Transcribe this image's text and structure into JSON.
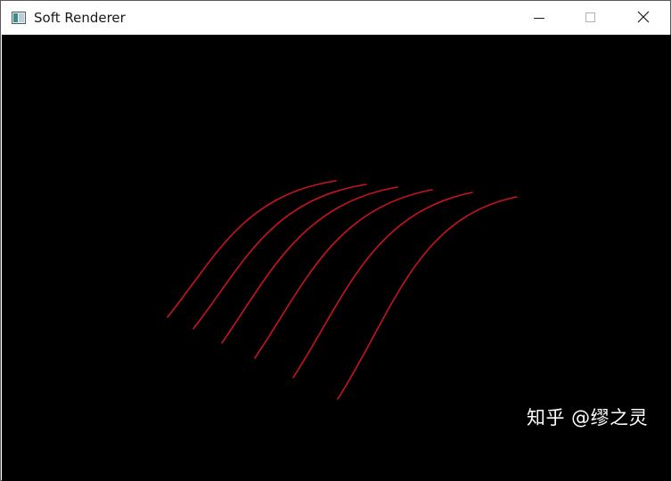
{
  "window": {
    "title": "Soft Renderer",
    "app_icon": "app-window-icon",
    "controls": {
      "minimize_icon": "minimize-icon",
      "maximize_icon": "maximize-icon",
      "close_icon": "close-icon"
    }
  },
  "canvas": {
    "background": "#000000",
    "curve_color": "#c8141e",
    "curve_count": 6
  },
  "watermark": {
    "text": "知乎 @缪之灵"
  }
}
